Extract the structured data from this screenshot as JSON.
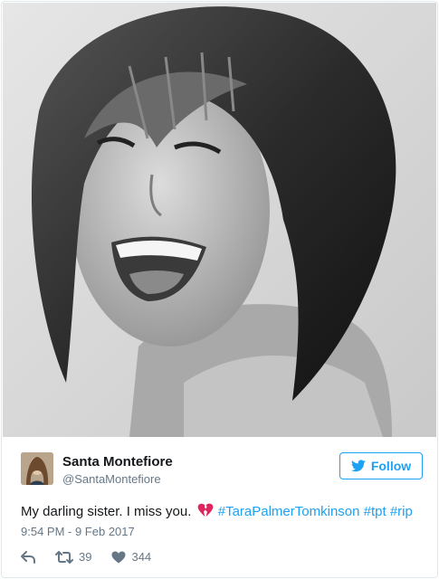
{
  "tweet": {
    "author_name": "Santa Montefiore",
    "author_handle": "@SantaMontefiore",
    "follow_label": "Follow",
    "text_prefix": "My darling sister. I miss you.",
    "emoji_icon": "broken-heart-icon",
    "hashtags": [
      "#TaraPalmerTomkinson",
      "#tpt",
      "#rip"
    ],
    "timestamp": "9:54 PM - 9 Feb 2017",
    "retweet_count": "39",
    "like_count": "344"
  },
  "icons": {
    "reply": "reply-icon",
    "retweet": "retweet-icon",
    "like": "heart-icon",
    "follow": "twitter-bird-icon"
  },
  "colors": {
    "accent": "#1da1f2",
    "secondary_text": "#657786",
    "primary_text": "#14171a",
    "emoji": "#e0245e"
  }
}
